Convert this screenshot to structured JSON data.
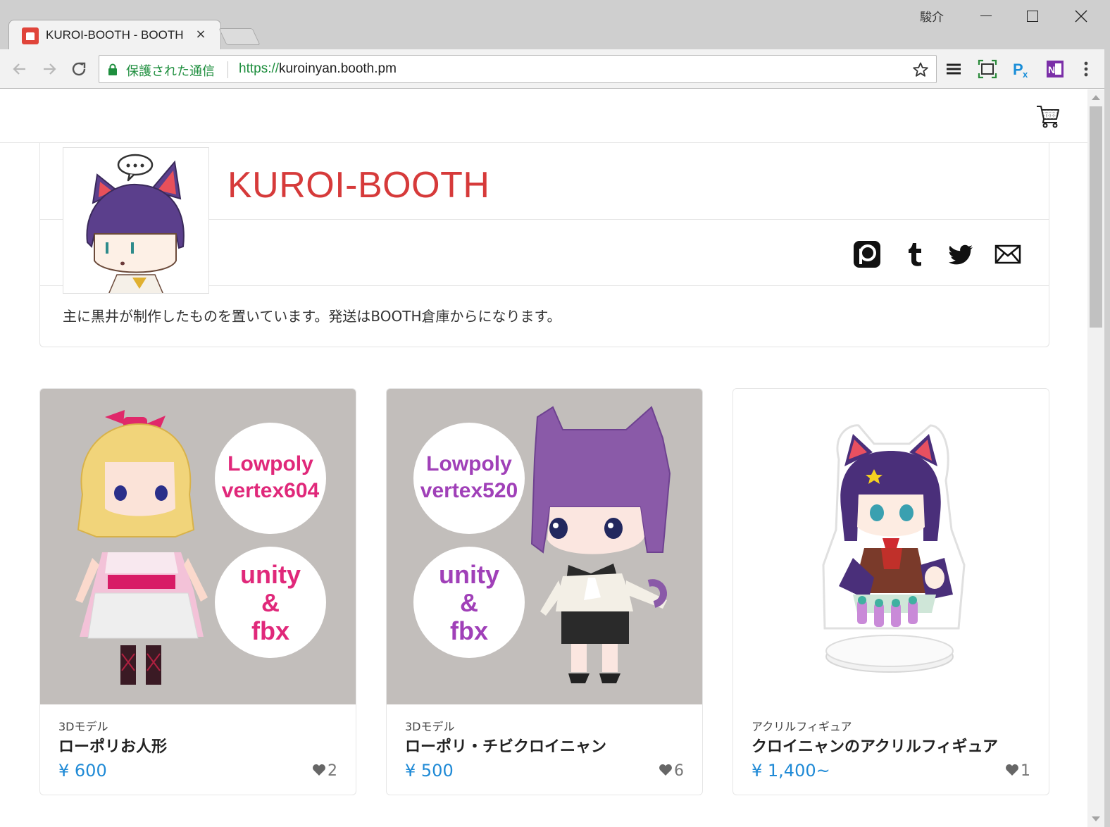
{
  "browser": {
    "tab_title": "KUROI-BOOTH - BOOTH",
    "tab_close": "×",
    "user_label": "駿介",
    "security_text": "保護された通信",
    "url_scheme": "https://",
    "url_host": "kuroinyan.booth.pm"
  },
  "shop": {
    "name": "KUROI-BOOTH",
    "description": "主に黒井が制作したものを置いています。発送はBOOTH倉庫からになります。"
  },
  "items": [
    {
      "category": "3Dモデル",
      "name": "ローポリお人形",
      "price": "¥ 600",
      "likes": "2",
      "badge_line1": "Lowpoly",
      "badge_line2": "vertex604",
      "badge2_line1": "unity",
      "badge2_line2": "&",
      "badge2_line3": "fbx"
    },
    {
      "category": "3Dモデル",
      "name": "ローポリ・チビクロイニャン",
      "price": "¥ 500",
      "likes": "6",
      "badge_line1": "Lowpoly",
      "badge_line2": "vertex520",
      "badge2_line1": "unity",
      "badge2_line2": "&",
      "badge2_line3": "fbx"
    },
    {
      "category": "アクリルフィギュア",
      "name": "クロイニャンのアクリルフィギュア",
      "price": "¥ 1,400~",
      "likes": "1"
    }
  ],
  "colors": {
    "shop_name": "#d63a3a",
    "price": "#1f8ad6",
    "secure": "#1e8e3e",
    "thumb_bg": "#c2bebb"
  },
  "icons": [
    "lock-icon",
    "star-icon",
    "cart-icon",
    "pixiv-icon",
    "tumblr-icon",
    "twitter-icon",
    "mail-icon",
    "heart-icon"
  ]
}
